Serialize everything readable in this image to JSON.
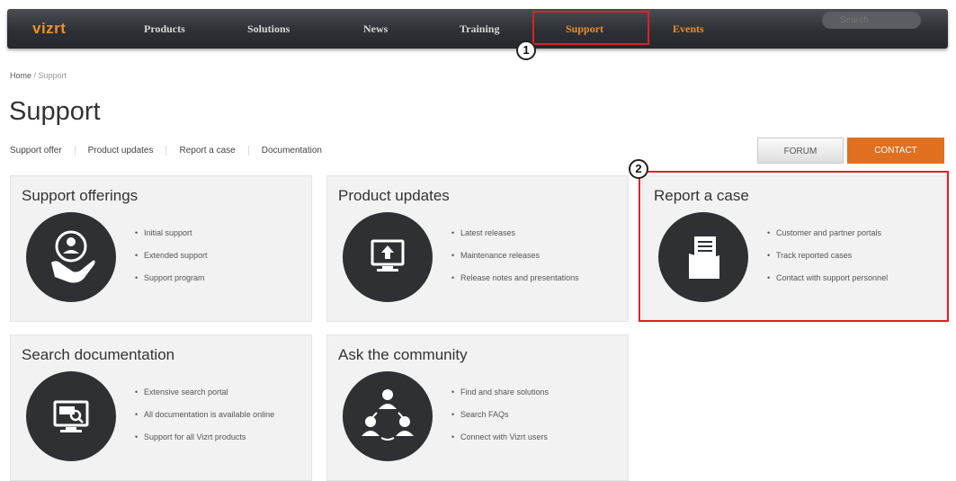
{
  "nav": {
    "logo": "vizrt",
    "items": [
      "Products",
      "Solutions",
      "News",
      "Training",
      "Support",
      "Events"
    ],
    "search_placeholder": "Search"
  },
  "callouts": [
    "1",
    "2"
  ],
  "breadcrumb": {
    "home": "Home",
    "separator": " / ",
    "current": "Support"
  },
  "page_title": "Support",
  "subnav": [
    "Support offer",
    "Product updates",
    "Report a case",
    "Documentation"
  ],
  "buttons": {
    "forum": "FORUM",
    "contact": "CONTACT"
  },
  "cards": [
    {
      "title": "Support offerings",
      "icon": "hand-person-icon",
      "bullets": [
        "Initial support",
        "Extended support",
        "Support program"
      ]
    },
    {
      "title": "Product updates",
      "icon": "monitor-upload-icon",
      "bullets": [
        "Latest releases",
        "Maintenance releases",
        "Release notes and presentations"
      ]
    },
    {
      "title": "Report a case",
      "icon": "document-folder-icon",
      "bullets": [
        "Customer and partner portals",
        "Track reported cases",
        "Contact with support personnel"
      ]
    },
    {
      "title": "Search documentation",
      "icon": "monitor-search-icon",
      "bullets": [
        "Extensive search portal",
        "All documentation is available online",
        "Support for all Vizrt products"
      ]
    },
    {
      "title": "Ask the community",
      "icon": "community-icon",
      "bullets": [
        "Find and share solutions",
        "Search FAQs",
        "Connect with Vizrt users"
      ]
    }
  ],
  "colors": {
    "accent": "#e07020",
    "nav_active": "#f08c2a",
    "highlight": "#e02027",
    "nav_bg": "#2d3035"
  }
}
